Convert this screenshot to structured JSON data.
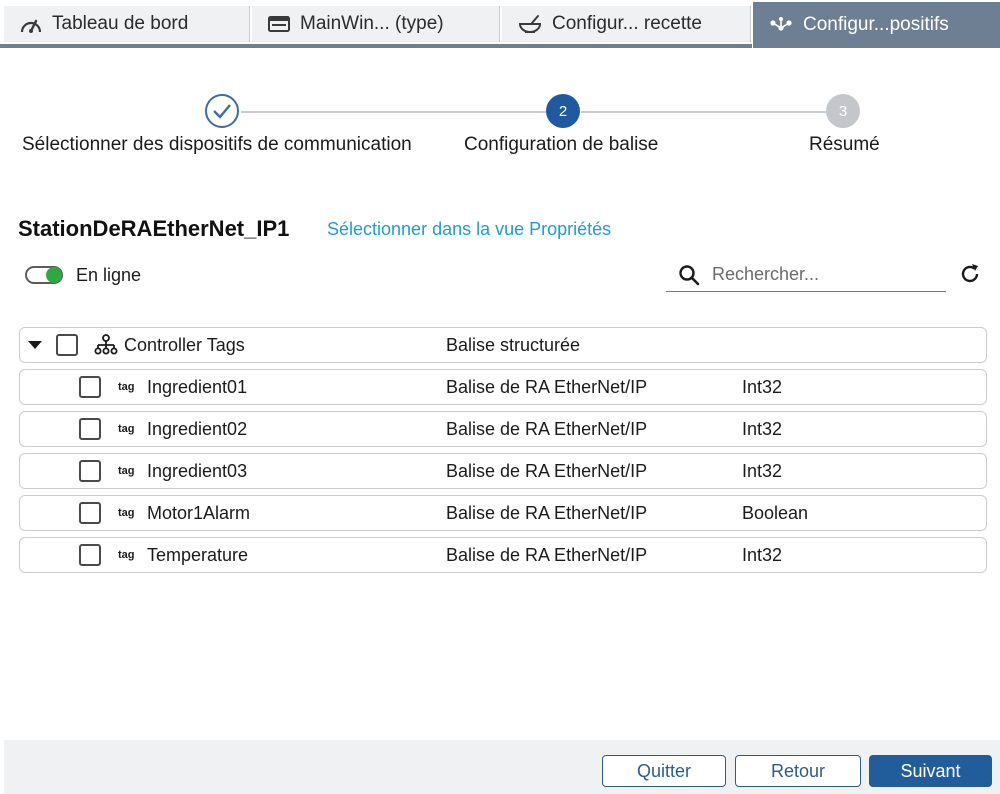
{
  "tabs": [
    {
      "label": "Tableau de bord",
      "icon": "dashboard-icon"
    },
    {
      "label": "MainWin... (type)",
      "icon": "window-icon"
    },
    {
      "label": "Configur... recette",
      "icon": "recipe-bowl-icon"
    },
    {
      "label": "Configur...positifs",
      "icon": "devices-network-icon",
      "active": true
    }
  ],
  "stepper": {
    "steps": [
      {
        "label": "Sélectionner des dispositifs de communication",
        "state": "done",
        "number": ""
      },
      {
        "label": "Configuration de balise",
        "state": "current",
        "number": "2"
      },
      {
        "label": "Résumé",
        "state": "pending",
        "number": "3"
      }
    ]
  },
  "station": {
    "name": "StationDeRAEtherNet_IP1",
    "select_link": "Sélectionner dans la vue Propriétés"
  },
  "online_toggle": {
    "label": "En ligne",
    "on": true,
    "color": "#2bab3f"
  },
  "search": {
    "placeholder": "Rechercher..."
  },
  "tree": {
    "root": {
      "name": "Controller Tags",
      "type": "Balise structurée"
    },
    "tag_icon_text": "tag",
    "rows": [
      {
        "name": "Ingredient01",
        "type": "Balise de RA EtherNet/IP",
        "datatype": "Int32"
      },
      {
        "name": "Ingredient02",
        "type": "Balise de RA EtherNet/IP",
        "datatype": "Int32"
      },
      {
        "name": "Ingredient03",
        "type": "Balise de RA EtherNet/IP",
        "datatype": "Int32"
      },
      {
        "name": "Motor1Alarm",
        "type": "Balise de RA EtherNet/IP",
        "datatype": "Boolean"
      },
      {
        "name": "Temperature",
        "type": "Balise de RA EtherNet/IP",
        "datatype": "Int32"
      }
    ]
  },
  "footer": {
    "quit": "Quitter",
    "back": "Retour",
    "next": "Suivant"
  },
  "colors": {
    "accent": "#215c9b",
    "link": "#1f9bd6",
    "active_tab": "#6f7f93"
  }
}
